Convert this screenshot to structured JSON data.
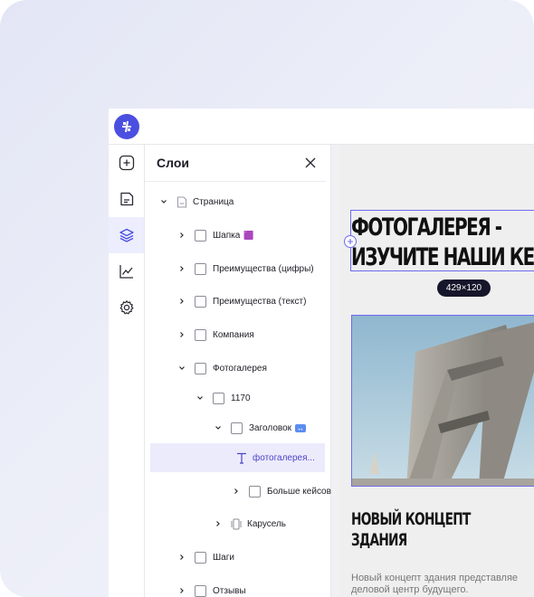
{
  "panel": {
    "title": "Слои"
  },
  "tree": [
    {
      "label": "Страница",
      "badge": ""
    },
    {
      "label": "Шапка",
      "badge": "🟪"
    },
    {
      "label": "Преимущества (цифры)",
      "badge": ""
    },
    {
      "label": "Преимущества (текст)",
      "badge": ""
    },
    {
      "label": "Компания",
      "badge": ""
    },
    {
      "label": "Фотогалерея",
      "badge": ""
    },
    {
      "label": "1170",
      "badge": ""
    },
    {
      "label": "Заголовок",
      "badge": "↔"
    },
    {
      "label": "фотогалерея...",
      "badge": ""
    },
    {
      "label": "Больше кейсов",
      "badge": ""
    },
    {
      "label": "Карусель",
      "badge": ""
    },
    {
      "label": "Шаги",
      "badge": ""
    },
    {
      "label": "Отзывы",
      "badge": ""
    }
  ],
  "canvas": {
    "heading_line1": "ФОТОГАЛЕРЕЯ -",
    "heading_line2": "ИЗУЧИТЕ НАШИ КЕ",
    "dimensions": "429×120",
    "sub_heading": "НОВЫЙ КОНЦЕПТ\nЗДАНИЯ",
    "body_line1": "Новый концепт здания представляе",
    "body_line2": "деловой центр будущего."
  },
  "colors": {
    "accent": "#4b4fe0",
    "selection": "#6e6af0",
    "selected_row_bg": "#ecebfc"
  }
}
